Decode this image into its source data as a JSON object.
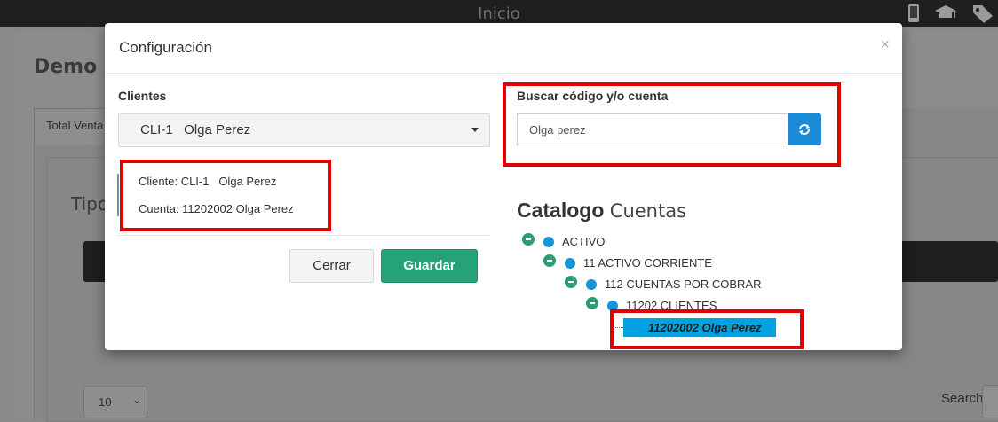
{
  "topbar": {
    "title": "Inicio",
    "icons": [
      "mobile-icon",
      "graduation-cap-icon",
      "tags-icon"
    ]
  },
  "background": {
    "page_title": "Demo P",
    "tab_label": "Total Venta",
    "section_title": "Tipo",
    "page_size": "10",
    "search_label": "Search:"
  },
  "modal": {
    "title": "Configuración",
    "close": "×",
    "clientes_label": "Clientes",
    "clientes_selected": "CLI-1   Olga Perez",
    "info_cliente": "Cliente: CLI-1   Olga Perez",
    "info_cuenta": "Cuenta: 11202002 Olga Perez",
    "btn_cerrar": "Cerrar",
    "btn_guardar": "Guardar",
    "search_label": "Buscar código y/o cuenta",
    "search_value": "Olga perez",
    "catalog_title_bold": "Catalogo",
    "catalog_title_rest": "Cuentas",
    "tree": [
      {
        "label": "ACTIVO"
      },
      {
        "label": "11 ACTIVO CORRIENTE"
      },
      {
        "label": "112 CUENTAS POR COBRAR"
      },
      {
        "label": "11202 CLIENTES"
      },
      {
        "label": "11202002 Olga Perez"
      }
    ]
  },
  "colors": {
    "highlight": "#e10000",
    "primary": "#26a27b",
    "accent": "#1a8ad6",
    "selected_node": "#00a2e0"
  }
}
